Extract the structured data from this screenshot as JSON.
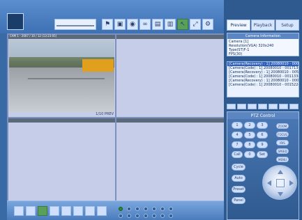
{
  "top_tabs": {
    "preview": "Preview",
    "playback": "Playback",
    "setup": "Setup"
  },
  "camera_info": {
    "title": "Camera Information",
    "lines": [
      "Camera [1]",
      "Resolution(VGA) 320x240",
      "Type(ST)F-1",
      "FPS(30)"
    ]
  },
  "camera_list": {
    "rows": [
      "[Camera(Recovery) : 1] 20080010 - 000015",
      "[Camera(Code) : 1] 20080010 - 0017134",
      "[Camera(Recovery) : 1] 20080010 - 005762",
      "[Camera(Code) : 1] 20080010 - 0011334",
      "[Camera(Recovery) : 1] 20080010 - 0005660",
      "[Camera(Code) : 1] 20080010 - 0015224"
    ],
    "selected_index": 0
  },
  "grid": {
    "panes": [
      {
        "header": "CAM 1 - 2007 / 10 / 12 (13:23:05)",
        "footer": "1/10 PREV",
        "has_video": true
      },
      {
        "header": "",
        "footer": "",
        "has_video": false
      },
      {
        "header": "",
        "footer": "",
        "has_video": false
      },
      {
        "header": "",
        "footer": "",
        "has_video": false
      }
    ]
  },
  "ptz": {
    "title": "PTZ Control",
    "left_buttons": [
      "1",
      "2",
      "3",
      "4",
      "5",
      "6",
      "7",
      "8",
      "9",
      "Call",
      "0",
      "Set"
    ],
    "labels": {
      "cycle": "Cycle",
      "auto_scan": "Auto",
      "preset": "Preset",
      "panel": "Panel"
    },
    "right_buttons": [
      "ZOOM",
      "FOCUS",
      "IRIS",
      "SPEED",
      "MENU"
    ]
  },
  "icons": {
    "logo": "logo-icon",
    "slider": "ptz-slider-icon",
    "tools": [
      "flag-icon",
      "camera-icon",
      "record-icon",
      "loop-icon",
      "image-icon",
      "window-icon",
      "arrow-icon",
      "zoom-icon",
      "settings-icon"
    ],
    "bottom": [
      "grid-1-icon",
      "grid-2-icon",
      "grid-3-icon",
      "grid-4-icon",
      "grid-5-icon",
      "grid-6-icon",
      "grid-7-icon",
      "grid-8-icon",
      "grid-9-icon",
      "grid-10-icon"
    ]
  },
  "bottom_dots": {
    "count": 14,
    "active_index": 0
  }
}
